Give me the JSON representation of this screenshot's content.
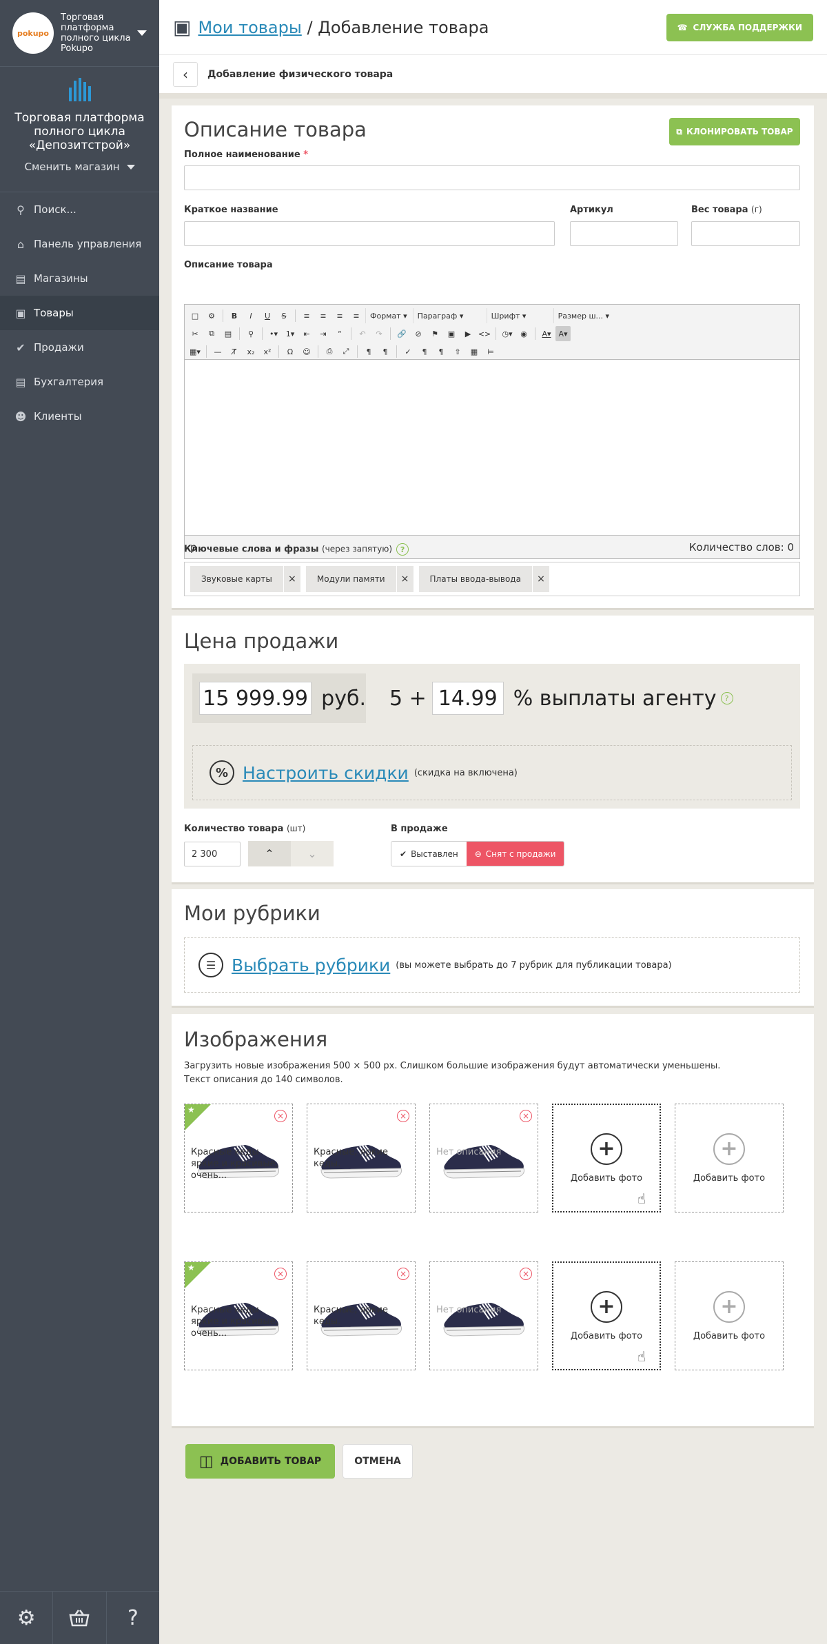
{
  "sidebar": {
    "shop_name": "Торговая платформа полного цикла Pokupo",
    "logo_text": "pokupo",
    "store_title": "Торговая платформа полного цикла «Депозитстрой»",
    "change_store": "Сменить магазин",
    "nav": [
      {
        "label": "Поиск...",
        "icon": "search-icon"
      },
      {
        "label": "Панель управления",
        "icon": "home-icon"
      },
      {
        "label": "Магазины",
        "icon": "store-icon"
      },
      {
        "label": "Товары",
        "icon": "boxes-icon"
      },
      {
        "label": "Продажи",
        "icon": "check-icon"
      },
      {
        "label": "Бухгалтерия",
        "icon": "document-icon"
      },
      {
        "label": "Клиенты",
        "icon": "users-icon"
      }
    ],
    "active_index": 3,
    "bottom": [
      "gears-icon",
      "basket-icon",
      "help-icon"
    ],
    "help_glyph": "?"
  },
  "header": {
    "crumb_link": "Мои товары",
    "crumb_current": "/ Добавление товара",
    "support_label": "СЛУЖБА ПОДДЕРЖКИ"
  },
  "subheader": {
    "title": "Добавление физического товара"
  },
  "description": {
    "title": "Описание товара",
    "clone_label": "КЛОНИРОВАТЬ ТОВАР",
    "full_name_label": "Полное наименование",
    "required_mark": "*",
    "short_name_label": "Краткое название",
    "sku_label": "Артикул",
    "weight_label": "Вес товара",
    "weight_unit": "(г)",
    "editor_label": "Описание товара",
    "editor": {
      "format": "Формат",
      "paragraph": "Параграф",
      "font": "Шрифт",
      "size": "Размер ш...",
      "path": "p",
      "word_count": "Количество слов: 0"
    },
    "keywords_label": "Ключевые слова и фразы",
    "keywords_hint": "(через запятую)",
    "help_glyph": "?",
    "remove_glyph": "×",
    "tags": [
      "Звуковые карты",
      "Модули памяти",
      "Платы ввода-вывода"
    ]
  },
  "price": {
    "title": "Цена продажи",
    "price_value": "15 999.99",
    "currency": "руб.",
    "agent_prefix": "5 +",
    "agent_value": "14.99",
    "agent_label": "% выплаты агенту",
    "help_glyph": "?",
    "discount_glyph": "%",
    "discount_link": "Настроить скидки",
    "discount_note": "(скидка на включена)",
    "qty_label": "Количество товара",
    "qty_unit": "(шт)",
    "qty_value": "2 300",
    "on_sale_label": "В продаже",
    "status_on": "Выставлен",
    "status_off": "Снят с продажи",
    "selected_status": "Снят с продажи"
  },
  "rubrics": {
    "title": "Мои рубрики",
    "icon_glyph": "☰",
    "link": "Выбрать рубрики",
    "note": "(вы можете выбрать до 7 рубрик для публикации товара)"
  },
  "images": {
    "title": "Изображения",
    "desc_line1": "Загрузить новые изображения 500 × 500 px. Слишком большие изображения будут автоматически уменьшены.",
    "desc_line2": "Текст описания до 140 символов.",
    "remove_glyph": "×",
    "star_glyph": "★",
    "plus_glyph": "+",
    "cursor_glyph": "☝",
    "add_photo": "Добавить фото",
    "captions": [
      "Красные кеды яркие и красивые, очень...",
      "Красные, яркие кеды.",
      "Нет описания"
    ]
  },
  "actions": {
    "submit": "ДОБАВИТЬ ТОВАР",
    "cancel": "ОТМЕНА"
  },
  "colors": {
    "accent_green": "#8cc152",
    "danger_red": "#ed5565",
    "link_blue": "#2a8ab8",
    "sidebar": "#434a54"
  }
}
